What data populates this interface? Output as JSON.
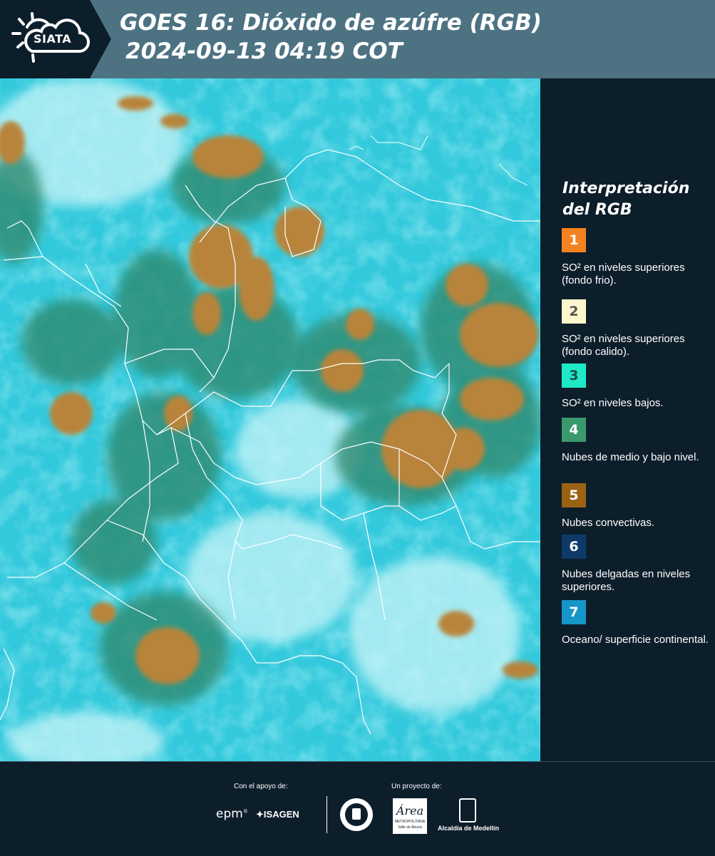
{
  "header": {
    "logo_text": "SIATA",
    "title_line1": "GOES 16: Dióxido de azúfre (RGB)",
    "title_line2": "2024-09-13 04:19 COT"
  },
  "legend": {
    "title_line1": "Interpretación",
    "title_line2": "del RGB",
    "items": [
      {
        "number": "1",
        "color": "#f58220",
        "text_color": "#ffffff",
        "label": "SO² en niveles superiores (fondo frio)."
      },
      {
        "number": "2",
        "color": "#fff6cc",
        "text_color": "#555555",
        "label": "SO² en niveles superiores (fondo calido)."
      },
      {
        "number": "3",
        "color": "#1de9c6",
        "text_color": "#1a4a4a",
        "label": "SO² en niveles bajos."
      },
      {
        "number": "4",
        "color": "#3a9a6e",
        "text_color": "#ffffff",
        "label": "Nubes de medio y bajo nivel."
      },
      {
        "number": "5",
        "color": "#9a6214",
        "text_color": "#ffffff",
        "label": "Nubes convectivas."
      },
      {
        "number": "6",
        "color": "#0e3a6a",
        "text_color": "#ffffff",
        "label": "Nubes delgadas en niveles superiores."
      },
      {
        "number": "7",
        "color": "#1596c8",
        "text_color": "#ffffff",
        "label": "Oceano/ superficie continental."
      }
    ]
  },
  "footer": {
    "support_label": "Con el apoyo de:",
    "project_label": "Un proyecto de:",
    "sponsors": [
      "epm",
      "ISAGEN"
    ],
    "partners": [
      "Área Metropolitana Valle de Aburrá",
      "Alcaldía de Medellín"
    ],
    "area_logo_text": "Área",
    "area_sub_text": "METROPOLITANA",
    "area_sub_text2": "Valle de Aburrá",
    "alcaldia_text": "Alcaldía de Medellín"
  },
  "map_colors": {
    "ocean": "#33c9dc",
    "haze": "#c8f4f8",
    "convective": "#b8843a",
    "midlevel": "#2f8a70",
    "borders": "#ffffff"
  }
}
